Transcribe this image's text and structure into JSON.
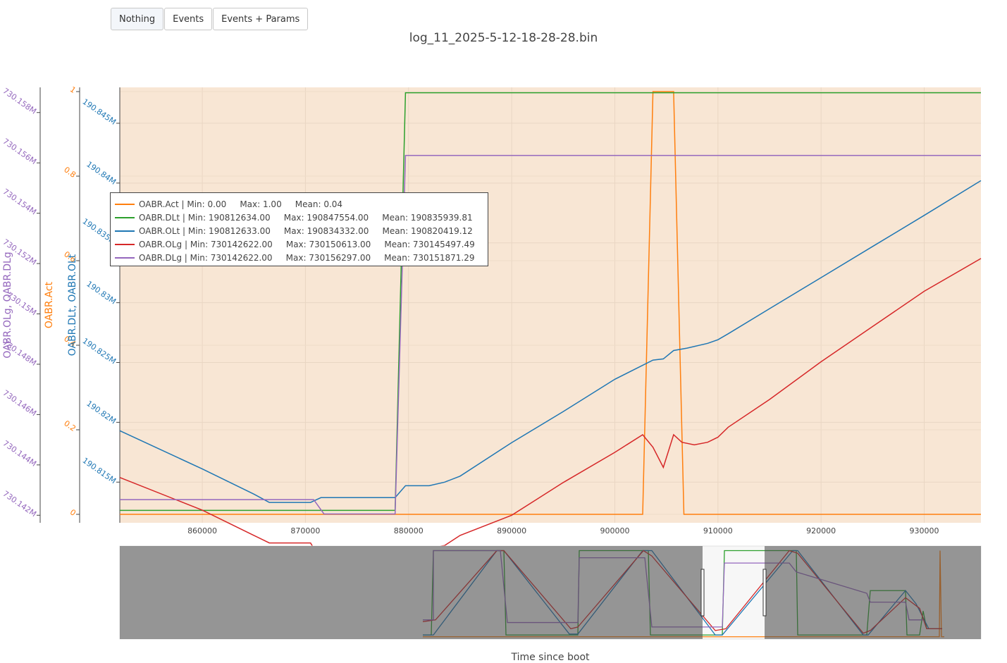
{
  "toolbar": {
    "buttons": [
      {
        "label": "Nothing",
        "active": true
      },
      {
        "label": "Events",
        "active": false
      },
      {
        "label": "Events + Params",
        "active": false
      }
    ]
  },
  "title": "log_11_2025-5-12-18-28-28.bin",
  "xlabel": "Time since boot",
  "colors": {
    "plot_bg": "#f8e6d4",
    "OABR.Act": "#ff7f0e",
    "OABR.DLt": "#2ca02c",
    "OABR.OLt": "#1f77b4",
    "OABR.OLg": "#d62728",
    "OABR.DLg": "#9467bd"
  },
  "legend": [
    {
      "series": "OABR.Act",
      "text": "OABR.Act | Min: 0.00     Max: 1.00     Mean: 0.04"
    },
    {
      "series": "OABR.DLt",
      "text": "OABR.DLt | Min: 190812634.00     Max: 190847554.00     Mean: 190835939.81"
    },
    {
      "series": "OABR.OLt",
      "text": "OABR.OLt | Min: 190812633.00     Max: 190834332.00     Mean: 190820419.12"
    },
    {
      "series": "OABR.OLg",
      "text": "OABR.OLg | Min: 730142622.00     Max: 730150613.00     Mean: 730145497.49"
    },
    {
      "series": "OABR.DLg",
      "text": "OABR.DLg | Min: 730142622.00     Max: 730156297.00     Mean: 730151871.29"
    }
  ],
  "chart_data": {
    "type": "line",
    "title": "log_11_2025-5-12-18-28-28.bin",
    "xlabel": "Time since boot",
    "xlim": [
      852000,
      935500
    ],
    "x_ticks": [
      860000,
      870000,
      880000,
      890000,
      900000,
      910000,
      920000,
      930000
    ],
    "x_tick_labels": [
      "860000",
      "870000",
      "880000",
      "890000",
      "900000",
      "910000",
      "920000",
      "930000"
    ],
    "axes": [
      {
        "id": "lg",
        "title": "OABR.OLg, OABR.DLg",
        "color": "#9467bd",
        "range": [
          730141700,
          730159000
        ],
        "ticks": [
          730142000,
          730144000,
          730146000,
          730148000,
          730150000,
          730152000,
          730154000,
          730156000,
          730158000
        ],
        "tick_labels": [
          "730.142M",
          "730.144M",
          "730.146M",
          "730.148M",
          "730.15M",
          "730.152M",
          "730.154M",
          "730.156M",
          "730.158M"
        ]
      },
      {
        "id": "act",
        "title": "OABR.Act",
        "color": "#ff7f0e",
        "range": [
          -0.02,
          1.01
        ],
        "ticks": [
          0,
          0.2,
          0.4,
          0.6,
          0.8,
          1
        ],
        "tick_labels": [
          "0",
          "0.2",
          "0.4",
          "0.6",
          "0.8",
          "1"
        ]
      },
      {
        "id": "lt",
        "title": "OABR.DLt, OABR.OLt",
        "color": "#1f77b4",
        "range": [
          190811600,
          190848000
        ],
        "ticks": [
          190815000,
          190820000,
          190825000,
          190830000,
          190835000,
          190840000,
          190845000
        ],
        "tick_labels": [
          "190.815M",
          "190.82M",
          "190.825M",
          "190.83M",
          "190.835M",
          "190.84M",
          "190.845M"
        ]
      }
    ],
    "series": [
      {
        "name": "OABR.Act",
        "axis": "act",
        "color": "#ff7f0e",
        "x": [
          852000,
          902700,
          903700,
          905700,
          906700,
          935500
        ],
        "y": [
          0,
          0,
          1,
          1,
          0,
          0
        ]
      },
      {
        "name": "OABR.DLt",
        "axis": "lt",
        "color": "#2ca02c",
        "x": [
          852000,
          878700,
          879700,
          935500
        ],
        "y": [
          190812634,
          190812634,
          190847554,
          190847554
        ]
      },
      {
        "name": "OABR.OLt",
        "axis": "lt",
        "color": "#1f77b4",
        "x": [
          852000,
          860000,
          865000,
          866500,
          870500,
          871500,
          878700,
          879700,
          882000,
          883500,
          885000,
          890000,
          895000,
          900000,
          903700,
          904700,
          905700,
          907000,
          909000,
          910000,
          911000,
          915000,
          920000,
          925000,
          930000,
          935500
        ],
        "y": [
          190819300,
          190816100,
          190814000,
          190813300,
          190813300,
          190813700,
          190813700,
          190814700,
          190814700,
          190815000,
          190815500,
          190818300,
          190820900,
          190823600,
          190825200,
          190825300,
          190826000,
          190826200,
          190826600,
          190826900,
          190827400,
          190829500,
          190832100,
          190834700,
          190837300,
          190840200
        ]
      },
      {
        "name": "OABR.OLg",
        "axis": "lg",
        "color": "#d62728",
        "x": [
          852000,
          860000,
          865000,
          866500,
          870500,
          871500,
          878700,
          879700,
          882000,
          883500,
          885000,
          890000,
          895000,
          900000,
          902700,
          903700,
          904700,
          905700,
          906500,
          907700,
          909000,
          910000,
          911000,
          915000,
          920000,
          925000,
          930000,
          935500
        ],
        "y": [
          730143500,
          730142200,
          730141200,
          730140900,
          730140900,
          730140200,
          730140200,
          730140600,
          730140700,
          730140800,
          730141200,
          730142000,
          730143300,
          730144500,
          730145200,
          730144700,
          730143900,
          730145200,
          730144900,
          730144800,
          730144900,
          730145100,
          730145500,
          730146600,
          730148100,
          730149500,
          730150900,
          730152200
        ]
      },
      {
        "name": "OABR.DLg",
        "axis": "lg",
        "color": "#9467bd",
        "x": [
          852000,
          870800,
          871800,
          878700,
          879700,
          935500
        ],
        "y": [
          730142622,
          730142622,
          730142050,
          730142050,
          730156297,
          730156297
        ]
      }
    ],
    "grid": true,
    "legend_position": "top-left inside plot"
  }
}
